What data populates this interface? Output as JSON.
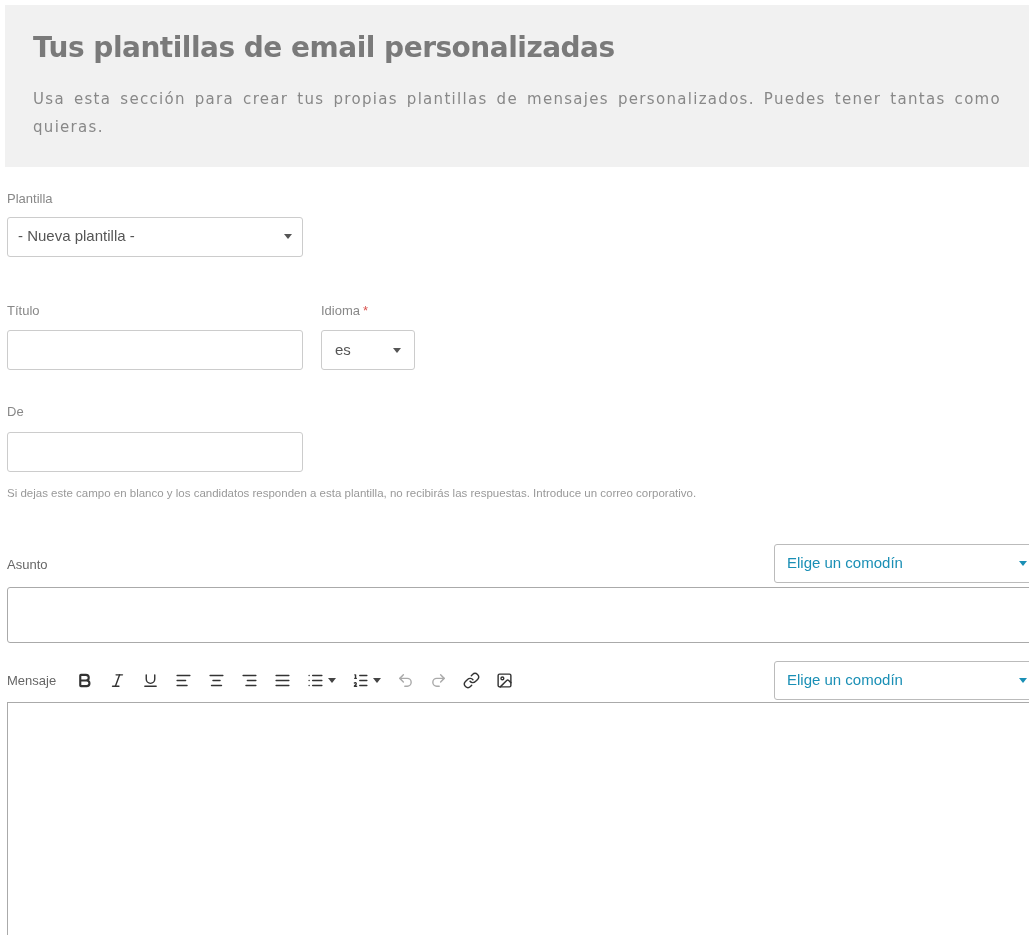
{
  "header": {
    "title": "Tus plantillas de email personalizadas",
    "description": "Usa esta sección para crear tus propias plantillas de mensajes personalizados. Puedes tener tantas como quieras."
  },
  "template_field": {
    "label": "Plantilla",
    "value": "- Nueva plantilla -"
  },
  "title_field": {
    "label": "Título"
  },
  "language_field": {
    "label": "Idioma",
    "required_mark": "*",
    "value": "es"
  },
  "from_field": {
    "label": "De",
    "help": "Si dejas este campo en blanco y los candidatos responden a esta plantilla, no recibirás las respuestas. Introduce un correo corporativo."
  },
  "subject_field": {
    "label": "Asunto",
    "wildcard": "Elige un comodín"
  },
  "message_field": {
    "label": "Mensaje",
    "wildcard": "Elige un comodín",
    "toolbar": [
      {
        "kind": "bold"
      },
      {
        "kind": "italic"
      },
      {
        "kind": "underline"
      },
      {
        "kind": "align-left"
      },
      {
        "kind": "align-center"
      },
      {
        "kind": "align-right"
      },
      {
        "kind": "align-justify"
      },
      {
        "kind": "bullet-list"
      },
      {
        "kind": "numbered-list"
      },
      {
        "kind": "undo"
      },
      {
        "kind": "redo"
      },
      {
        "kind": "link"
      },
      {
        "kind": "image"
      }
    ]
  }
}
